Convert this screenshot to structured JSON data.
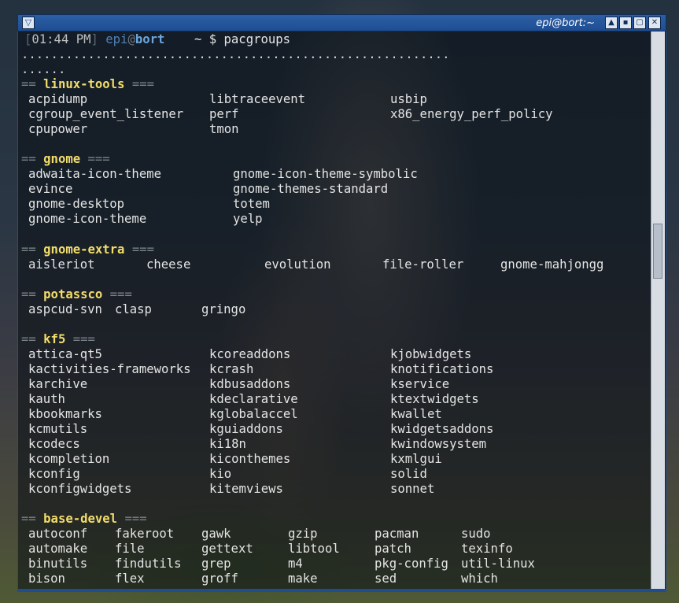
{
  "window": {
    "title": "epi@bort:~",
    "menu_glyph": "▽",
    "buttons": {
      "shade": "▲",
      "minimize": "▪",
      "maximize": "▢",
      "close": "✕"
    }
  },
  "prompt": {
    "open_bracket": "[",
    "time": "01:44 PM",
    "close_bracket": "]",
    "user": "epi",
    "at": "@",
    "host": "bort",
    "path_and_symbol": "~ $",
    "command": "pacgroups"
  },
  "progress": {
    "line1": "..........................................................",
    "line2": "......"
  },
  "groups": [
    {
      "name": "linux-tools",
      "eq_left": "==",
      "eq_right": "===",
      "col_x": [
        0,
        230,
        460
      ],
      "rows": [
        [
          "acpidump",
          "libtraceevent",
          "usbip"
        ],
        [
          "cgroup_event_listener",
          "perf",
          "x86_energy_perf_policy"
        ],
        [
          "cpupower",
          "tmon",
          ""
        ]
      ]
    },
    {
      "name": "gnome",
      "eq_left": "==",
      "eq_right": "===",
      "col_x": [
        0,
        260
      ],
      "rows": [
        [
          "adwaita-icon-theme",
          "gnome-icon-theme-symbolic"
        ],
        [
          "evince",
          "gnome-themes-standard"
        ],
        [
          "gnome-desktop",
          "totem"
        ],
        [
          "gnome-icon-theme",
          "yelp"
        ]
      ]
    },
    {
      "name": "gnome-extra",
      "eq_left": "==",
      "eq_right": "===",
      "col_x": [
        0,
        150,
        300,
        450,
        600
      ],
      "rows": [
        [
          "aisleriot",
          "cheese",
          "evolution",
          "file-roller",
          "gnome-mahjongg"
        ]
      ]
    },
    {
      "name": "potassco",
      "eq_left": "==",
      "eq_right": "===",
      "col_x": [
        0,
        110,
        220
      ],
      "rows": [
        [
          "aspcud-svn",
          "clasp",
          "gringo"
        ]
      ]
    },
    {
      "name": "kf5",
      "eq_left": "==",
      "eq_right": "===",
      "col_x": [
        0,
        230,
        460
      ],
      "rows": [
        [
          "attica-qt5",
          "kcoreaddons",
          "kjobwidgets"
        ],
        [
          "kactivities-frameworks",
          "kcrash",
          "knotifications"
        ],
        [
          "karchive",
          "kdbusaddons",
          "kservice"
        ],
        [
          "kauth",
          "kdeclarative",
          "ktextwidgets"
        ],
        [
          "kbookmarks",
          "kglobalaccel",
          "kwallet"
        ],
        [
          "kcmutils",
          "kguiaddons",
          "kwidgetsaddons"
        ],
        [
          "kcodecs",
          "ki18n",
          "kwindowsystem"
        ],
        [
          "kcompletion",
          "kiconthemes",
          "kxmlgui"
        ],
        [
          "kconfig",
          "kio",
          "solid"
        ],
        [
          "kconfigwidgets",
          "kitemviews",
          "sonnet"
        ]
      ]
    },
    {
      "name": "base-devel",
      "eq_left": "==",
      "eq_right": "===",
      "col_x": [
        0,
        110,
        220,
        330,
        440,
        550
      ],
      "rows": [
        [
          "autoconf",
          "fakeroot",
          "gawk",
          "gzip",
          "pacman",
          "sudo"
        ],
        [
          "automake",
          "file",
          "gettext",
          "libtool",
          "patch",
          "texinfo"
        ],
        [
          "binutils",
          "findutils",
          "grep",
          "m4",
          "pkg-config",
          "util-linux"
        ],
        [
          "bison",
          "flex",
          "groff",
          "make",
          "sed",
          "which"
        ]
      ]
    }
  ]
}
